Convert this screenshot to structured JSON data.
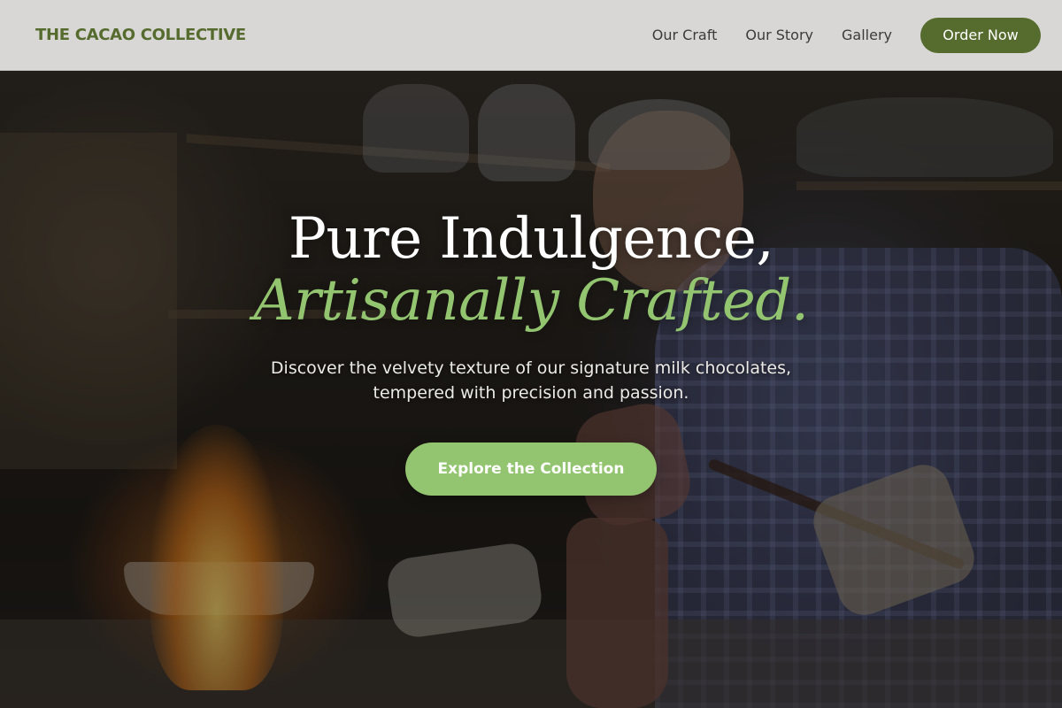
{
  "nav": {
    "brand": "THE CACAO COLLECTIVE",
    "links": [
      "Our Craft",
      "Our Story",
      "Gallery"
    ],
    "cta": "Order Now"
  },
  "hero": {
    "headline_line1": "Pure Indulgence,",
    "headline_line2": "Artisanally Crafted.",
    "tagline": "Discover the velvety texture of our signature milk chocolates, tempered with precision and passion.",
    "cta": "Explore the Collection"
  },
  "colors": {
    "brand_green": "#566b2e",
    "accent_green": "#93c46f",
    "nav_background": "#d8d7d5"
  }
}
